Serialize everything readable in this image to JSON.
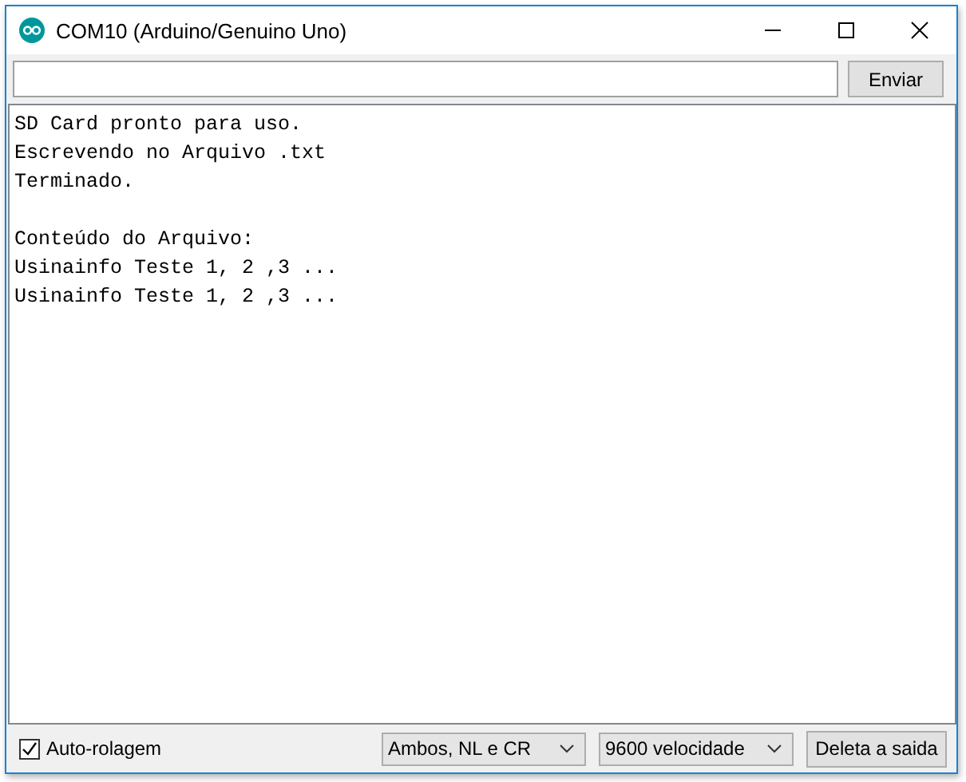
{
  "window": {
    "title": "COM10 (Arduino/Genuino Uno)"
  },
  "send_bar": {
    "button": "Enviar"
  },
  "output": [
    {
      "lines": [
        "SD Card pronto para uso.",
        "Escrevendo no Arquivo .txt",
        "Terminado."
      ]
    },
    {
      "lines": [
        "Conteúdo do Arquivo:",
        "Usinainfo Teste 1, 2 ,3 ...",
        "Usinainfo Teste 1, 2 ,3 ..."
      ]
    }
  ],
  "footer": {
    "autoscroll": {
      "label": "Auto-rolagem",
      "checked": true
    },
    "line_ending": "Ambos, NL e CR",
    "baud_rate": "9600 velocidade",
    "clear_button": "Deleta a saida"
  }
}
